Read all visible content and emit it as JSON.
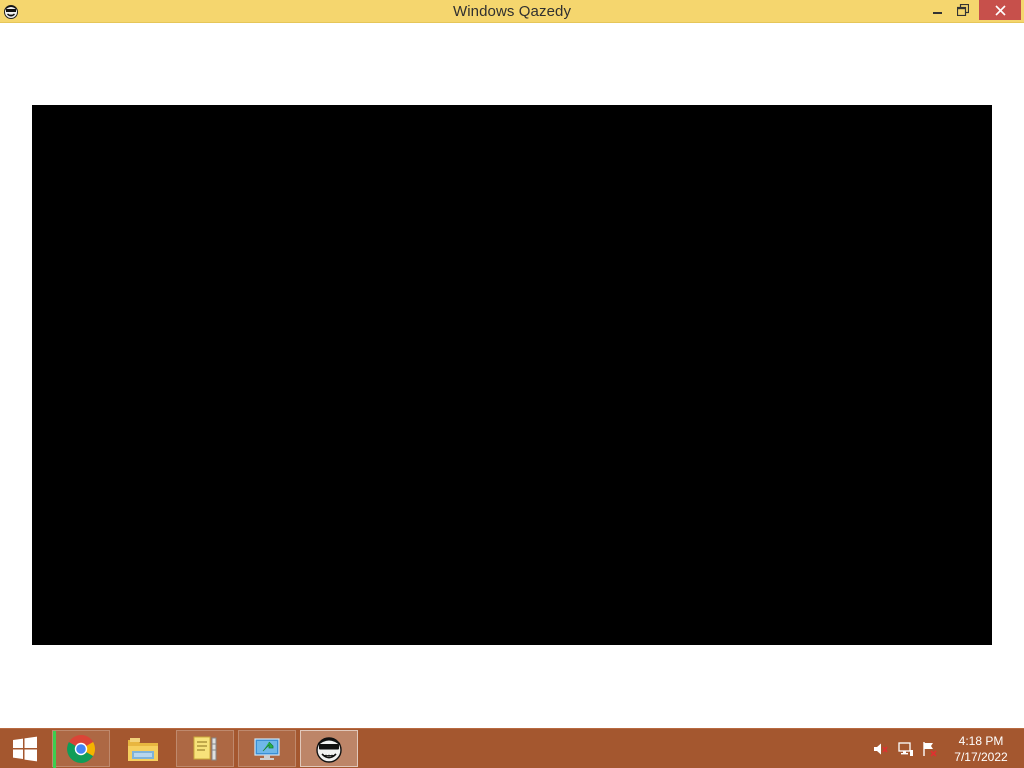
{
  "window": {
    "title": "Windows Qazedy",
    "app_icon": "qazedy-face-icon",
    "controls": {
      "minimize_icon": "minimize-icon",
      "restore_icon": "restore-icon",
      "close_icon": "close-icon",
      "close_color": "#c7504b"
    },
    "titlebar_color": "#f5d66e"
  },
  "content": {
    "background_color": "#ffffff",
    "video_surface_color": "#000000"
  },
  "taskbar": {
    "color": "#a4572f",
    "start_icon": "windows-logo-icon",
    "apps": [
      {
        "name": "chrome",
        "icon": "chrome-icon",
        "state": "running"
      },
      {
        "name": "explorer",
        "icon": "folder-icon",
        "state": "pinned"
      },
      {
        "name": "notes",
        "icon": "notes-icon",
        "state": "running"
      },
      {
        "name": "remote",
        "icon": "remote-desktop-icon",
        "state": "running"
      },
      {
        "name": "qazedy",
        "icon": "qazedy-face-icon",
        "state": "active"
      }
    ],
    "tray": {
      "icons": [
        "volume-muted-icon",
        "network-icon",
        "action-center-flag-icon"
      ]
    },
    "clock": {
      "time": "4:18 PM",
      "date": "7/17/2022"
    }
  }
}
